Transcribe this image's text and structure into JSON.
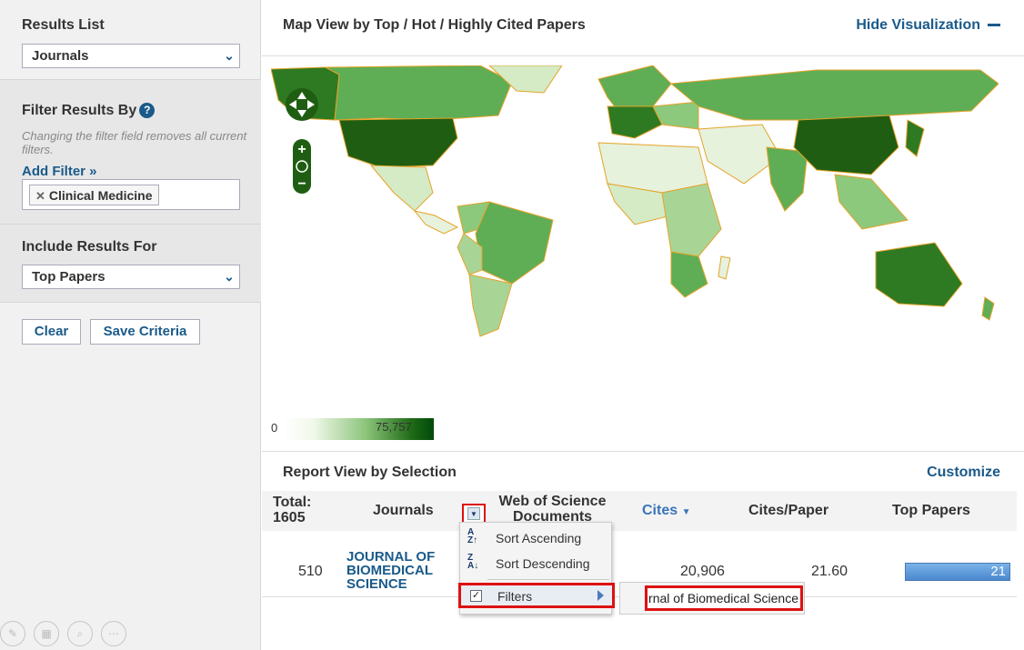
{
  "sidebar": {
    "results_list_title": "Results List",
    "results_list_value": "Journals",
    "filter_title": "Filter Results By",
    "filter_note": "Changing the filter field removes all current filters.",
    "add_filter": "Add Filter »",
    "filter_chip": "Clinical Medicine",
    "include_title": "Include Results For",
    "include_value": "Top Papers",
    "clear_label": "Clear",
    "save_label": "Save Criteria"
  },
  "map": {
    "title": "Map View by Top / Hot / Highly Cited Papers",
    "hide_label": "Hide Visualization",
    "legend_min": "0",
    "legend_max": "75,757",
    "colors": {
      "high": "#1f5e12",
      "mid": "#5fae55",
      "low": "#d4ebc5",
      "border": "#e6a32a"
    }
  },
  "report": {
    "title": "Report View by Selection",
    "customize": "Customize",
    "headers": {
      "total_label": "Total:",
      "total_value": "1605",
      "journals": "Journals",
      "wos_docs": "Web of Science Documents",
      "cites": "Cites",
      "cites_per_paper": "Cites/Paper",
      "top_papers": "Top Papers"
    },
    "row": {
      "rank": "510",
      "journal": "JOURNAL OF BIOMEDICAL SCIENCE",
      "cites": "20,906",
      "cites_per_paper": "21.60",
      "top_papers": "21"
    }
  },
  "menu": {
    "sort_ascending": "Sort Ascending",
    "sort_descending": "Sort Descending",
    "filters": "Filters",
    "filter_input_value": "Journal of Biomedical Science"
  }
}
